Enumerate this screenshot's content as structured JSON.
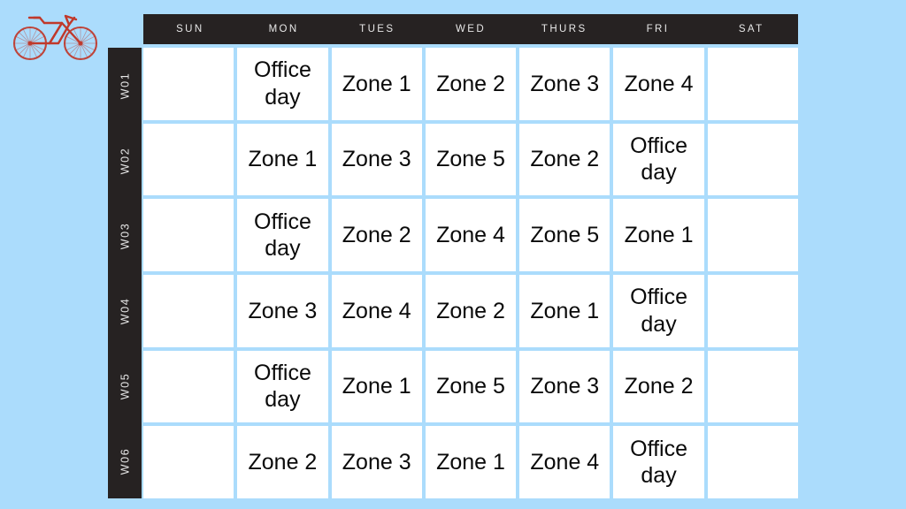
{
  "logo": {
    "name": "bicycle-logo",
    "color": "#C0392B",
    "alt": "bicycle"
  },
  "theme": {
    "background": "#ABDCFC",
    "header_bar": "#262222",
    "header_text": "#E8E8E8",
    "cell_background": "#FFFFFF",
    "cell_text": "#0A0A0A",
    "grid_line": "#ABDCFC"
  },
  "calendar": {
    "day_headers": [
      "SUN",
      "MON",
      "TUES",
      "WED",
      "THURS",
      "FRI",
      "SAT"
    ],
    "week_labels": [
      "W01",
      "W02",
      "W03",
      "W04",
      "W05",
      "W06"
    ],
    "rows": [
      {
        "week": "W01",
        "cells": [
          "",
          "Office day",
          "Zone 1",
          "Zone 2",
          "Zone 3",
          "Zone 4",
          ""
        ]
      },
      {
        "week": "W02",
        "cells": [
          "",
          "Zone 1",
          "Zone 3",
          "Zone 5",
          "Zone 2",
          "Office day",
          ""
        ]
      },
      {
        "week": "W03",
        "cells": [
          "",
          "Office day",
          "Zone 2",
          "Zone 4",
          "Zone 5",
          "Zone 1",
          ""
        ]
      },
      {
        "week": "W04",
        "cells": [
          "",
          "Zone 3",
          "Zone 4",
          "Zone 2",
          "Zone 1",
          "Office day",
          ""
        ]
      },
      {
        "week": "W05",
        "cells": [
          "",
          "Office day",
          "Zone 1",
          "Zone 5",
          "Zone 3",
          "Zone 2",
          ""
        ]
      },
      {
        "week": "W06",
        "cells": [
          "",
          "Zone 2",
          "Zone 3",
          "Zone 1",
          "Zone 4",
          "Office day",
          ""
        ]
      }
    ]
  }
}
